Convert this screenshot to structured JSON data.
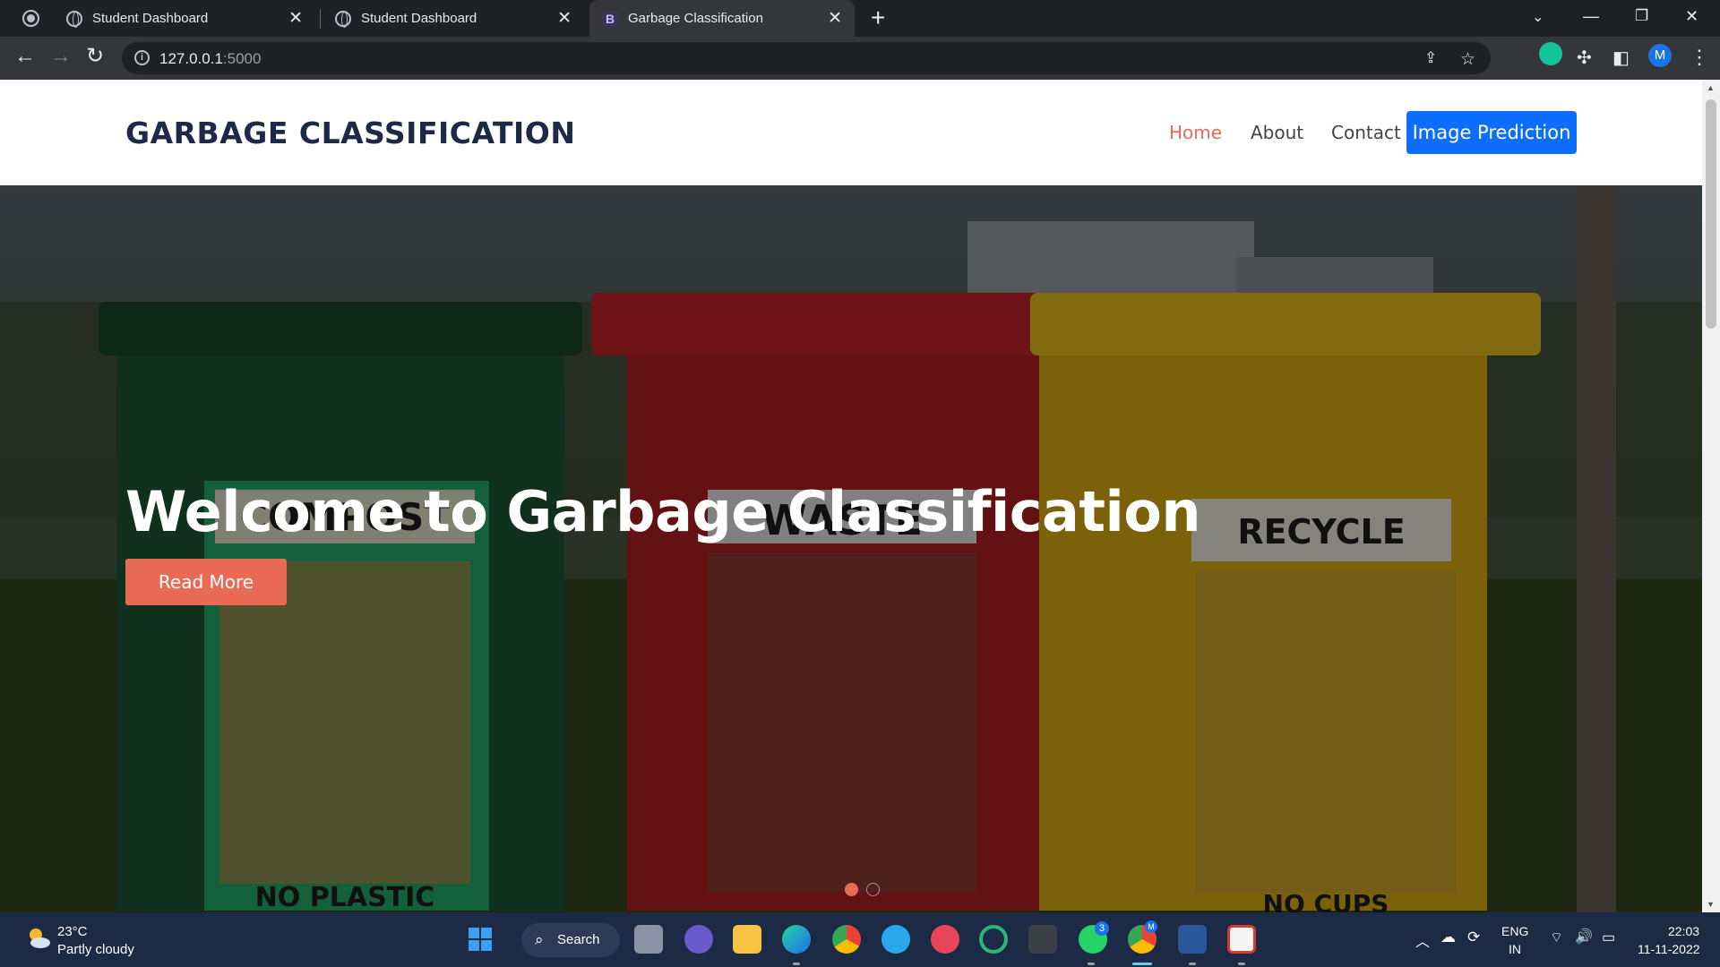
{
  "browser": {
    "tabs": [
      {
        "title": "Student Dashboard",
        "favicon": "globe-icon"
      },
      {
        "title": "Student Dashboard",
        "favicon": "globe-icon"
      },
      {
        "title": "Garbage Classification",
        "favicon": "bootstrap-b-icon",
        "favicon_text": "B",
        "active": true
      }
    ],
    "url_host": "127.0.0.1",
    "url_port": ":5000",
    "profile_initial": "M"
  },
  "site": {
    "brand": "GARBAGE CLASSIFICATION",
    "nav": [
      {
        "label": "Home",
        "active": true
      },
      {
        "label": "About"
      },
      {
        "label": "Contact"
      }
    ],
    "cta_label": "Image Prediction",
    "hero": {
      "title": "Welcome to Garbage Classification",
      "button_label": "Read More",
      "bin_signs": [
        "COMPOST",
        "WASTE",
        "RECYCLE",
        "NO PLASTIC",
        "NO CUPS"
      ],
      "carousel_slides": 2,
      "carousel_active": 1
    },
    "colors": {
      "accent": "#e96b56",
      "primary": "#0d6efd",
      "brand": "#1c2a48"
    }
  },
  "taskbar": {
    "weather_temp": "23°C",
    "weather_desc": "Partly cloudy",
    "search_label": "Search",
    "whatsapp_badge": "3",
    "chrome_badge": "M",
    "lang_top": "ENG",
    "lang_bottom": "IN",
    "time": "22:03",
    "date": "11-11-2022"
  }
}
